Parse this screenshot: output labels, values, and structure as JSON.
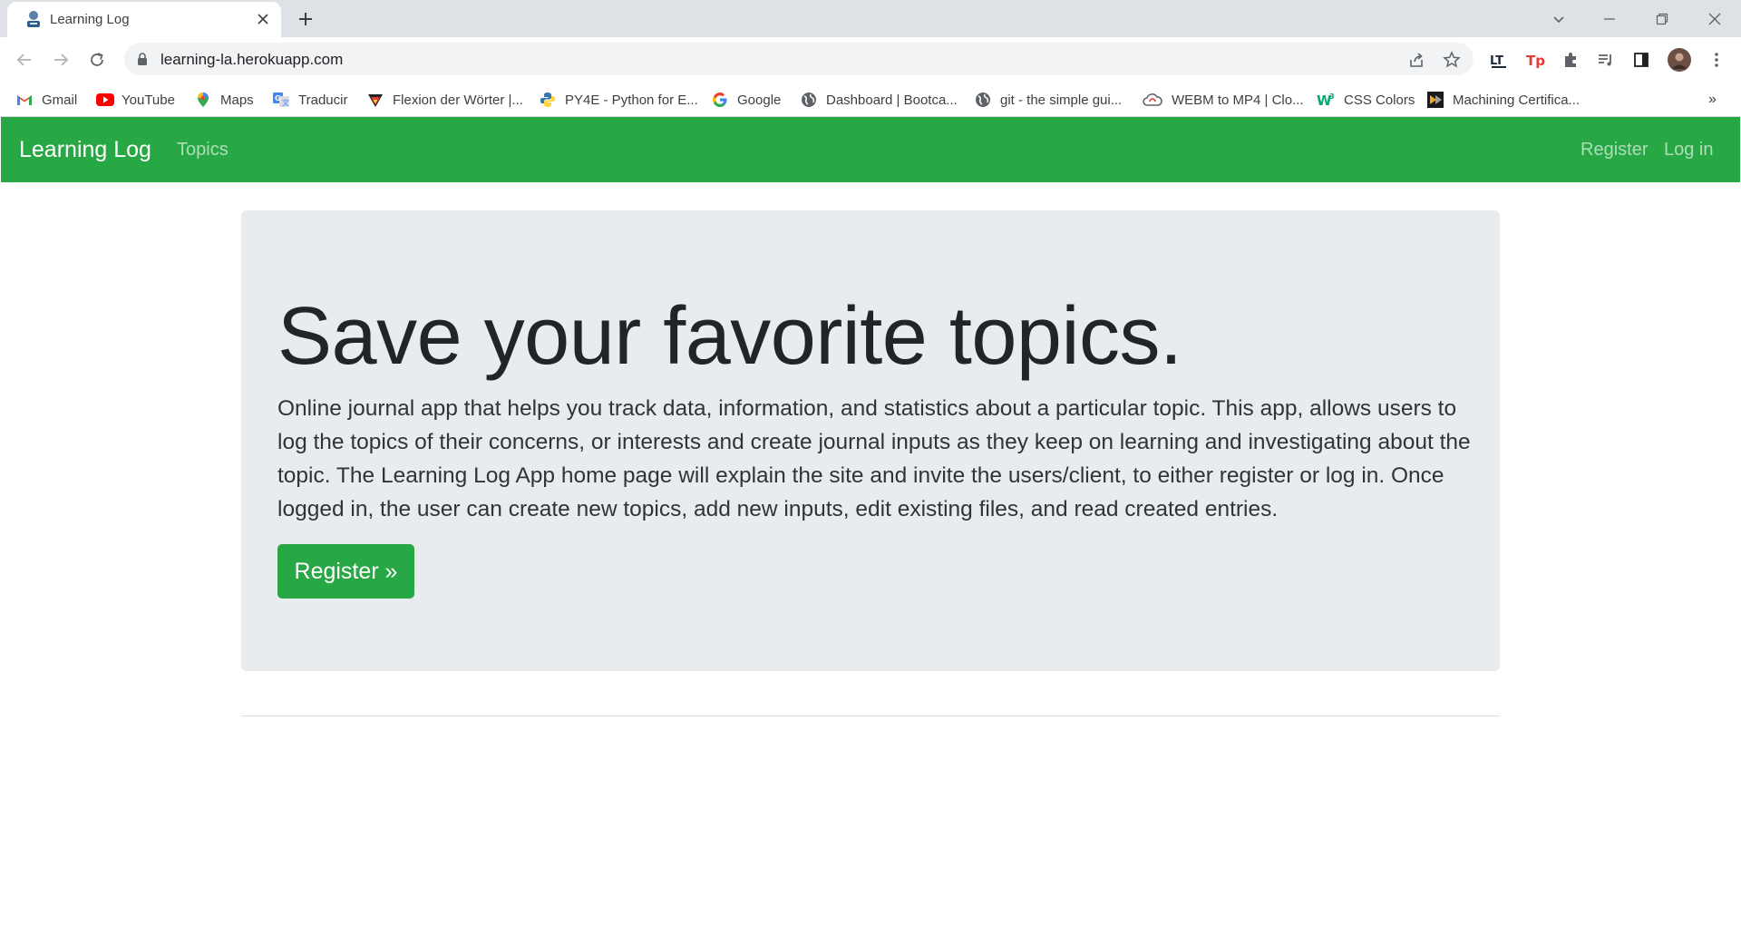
{
  "browser": {
    "tab_title": "Learning Log",
    "url": "learning-la.herokuapp.com",
    "bookmarks": [
      {
        "label": "Gmail",
        "icon": "gmail-icon"
      },
      {
        "label": "YouTube",
        "icon": "youtube-icon"
      },
      {
        "label": "Maps",
        "icon": "maps-icon"
      },
      {
        "label": "Traducir",
        "icon": "translate-icon"
      },
      {
        "label": "Flexion der Wörter |...",
        "icon": "flexion-icon"
      },
      {
        "label": "PY4E - Python for E...",
        "icon": "python-icon"
      },
      {
        "label": "Google",
        "icon": "google-icon"
      },
      {
        "label": "Dashboard | Bootca...",
        "icon": "globe-icon"
      },
      {
        "label": "git - the simple gui...",
        "icon": "globe-icon"
      },
      {
        "label": "WEBM to MP4 | Clo...",
        "icon": "cloudconvert-icon"
      },
      {
        "label": "CSS Colors",
        "icon": "w3schools-icon"
      },
      {
        "label": "Machining Certifica...",
        "icon": "machining-icon"
      }
    ],
    "overflow_label": "»"
  },
  "navbar": {
    "brand": "Learning Log",
    "topics": "Topics",
    "register": "Register",
    "login": "Log in"
  },
  "hero": {
    "title": "Save your favorite topics.",
    "text": "Online journal app that helps you track data, information, and statistics about a particular topic. This app, allows users to log the topics of their concerns, or interests and create journal inputs as they keep on learning and investigating about the topic. The Learning Log App home page will explain the site and invite the users/client, to either register or log in. Once logged in, the user can create new topics, add new inputs, edit existing files, and read created entries.",
    "button": "Register »"
  },
  "colors": {
    "brand_green": "#28a745",
    "jumbotron_bg": "#e9ecef"
  }
}
